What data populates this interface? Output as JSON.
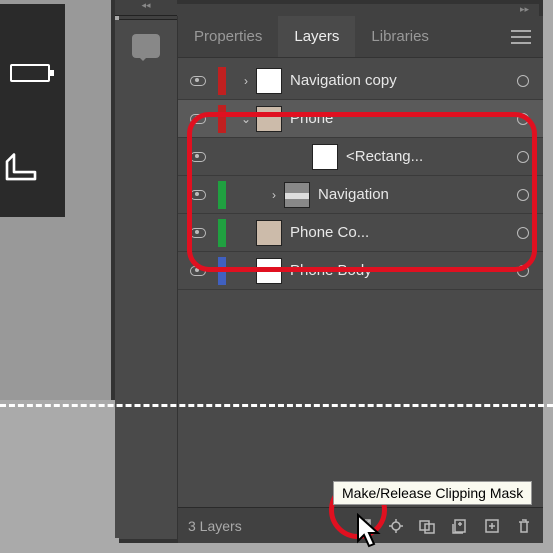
{
  "tabs": {
    "properties": "Properties",
    "layers": "Layers",
    "libraries": "Libraries"
  },
  "layers": [
    {
      "name": "Navigation copy",
      "edgeColor": "#c02020",
      "hasChildren": true,
      "expanded": false,
      "depth": 0,
      "thumb": "white",
      "selected": false
    },
    {
      "name": "Phone",
      "edgeColor": "#c02020",
      "hasChildren": true,
      "expanded": true,
      "depth": 0,
      "thumb": "phone",
      "selected": true
    },
    {
      "name": "<Rectang...",
      "edgeColor": "",
      "hasChildren": false,
      "expanded": false,
      "depth": 2,
      "thumb": "white",
      "selected": false
    },
    {
      "name": "Navigation",
      "edgeColor": "#20a040",
      "hasChildren": true,
      "expanded": false,
      "depth": 1,
      "thumb": "nav",
      "selected": false
    },
    {
      "name": "Phone Co...",
      "edgeColor": "#20a040",
      "hasChildren": false,
      "expanded": false,
      "depth": 0,
      "thumb": "phone",
      "selected": false
    },
    {
      "name": "Phone Body",
      "edgeColor": "#4060c0",
      "hasChildren": false,
      "expanded": false,
      "depth": 0,
      "thumb": "white",
      "selected": false
    }
  ],
  "footer": {
    "count": "3 Layers",
    "tooltip": "Make/Release Clipping Mask"
  }
}
